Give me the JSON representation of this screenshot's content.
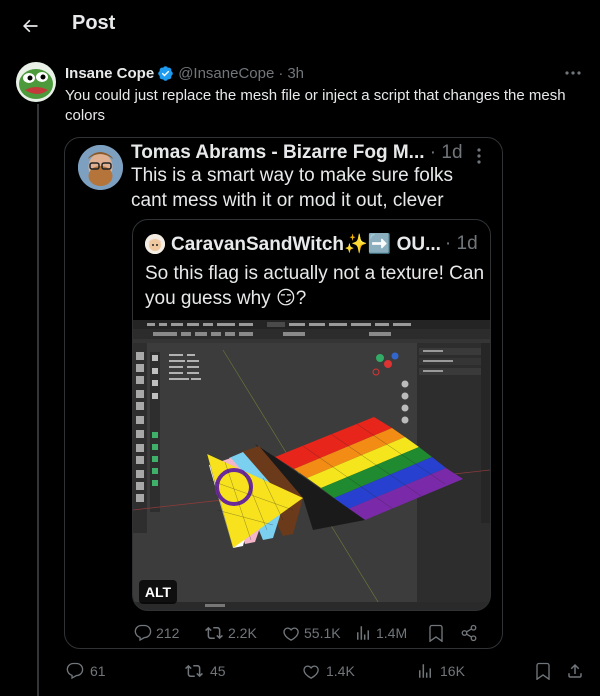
{
  "header": {
    "title": "Post"
  },
  "post": {
    "author_name": "Insane Cope",
    "handle": "@InsaneCope",
    "separator": "·",
    "time": "3h",
    "text": "You could just replace the mesh file or inject a script that changes the mesh colors"
  },
  "quote1": {
    "author_name": "Tomas Abrams - Bizarre Fog M...",
    "handle_time": "· 1d",
    "text": "This is a smart way to make sure folks cant mess with it or mod it out, clever",
    "actions": {
      "replies": "212",
      "reposts": "2.2K",
      "likes": "55.1K",
      "views": "1.4M"
    }
  },
  "quote2": {
    "author_name": "CaravanSandWitch✨➡️ OU...",
    "handle_time": "· 1d",
    "text": "So this flag is actually not a texture! Can you guess why 😏?",
    "media_alt_badge": "ALT"
  },
  "actions": {
    "replies": "61",
    "reposts": "45",
    "likes": "1.4K",
    "views": "16K"
  },
  "colors": {
    "background": "#000000",
    "text": "#e7e9ea",
    "muted": "#71767b",
    "border": "#2f3336",
    "verified": "#1d9bf0"
  }
}
